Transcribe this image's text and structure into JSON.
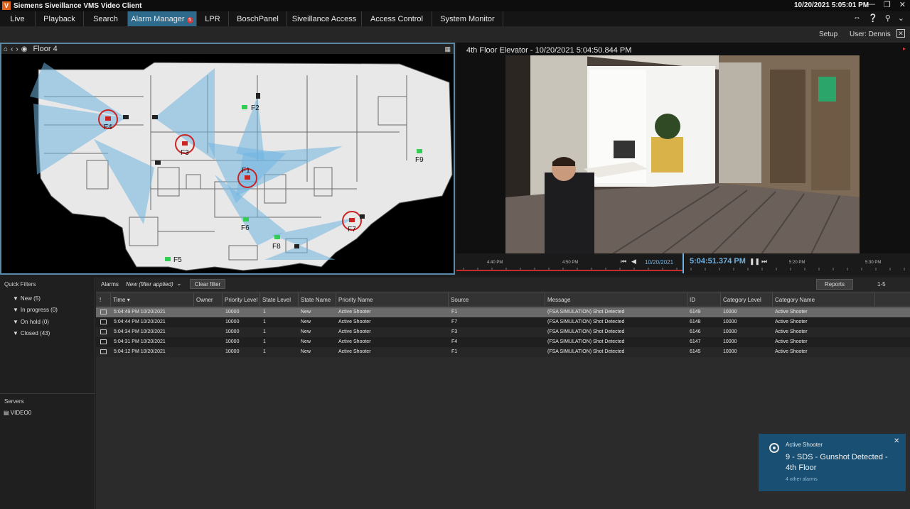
{
  "app": {
    "title": "Siemens Siveillance VMS Video Client",
    "logo_letter": "V",
    "clock": "10/20/2021 5:05:01 PM"
  },
  "tabs": [
    {
      "label": "Live"
    },
    {
      "label": "Playback"
    },
    {
      "label": "Search"
    },
    {
      "label": "Alarm Manager",
      "badge": "5"
    },
    {
      "label": "LPR"
    },
    {
      "label": "BoschPanel"
    },
    {
      "label": "Siveillance Access"
    },
    {
      "label": "Access Control"
    },
    {
      "label": "System Monitor"
    }
  ],
  "subbar": {
    "setup": "Setup",
    "user": "User: Dennis"
  },
  "map": {
    "title": "Floor 4",
    "markers": [
      "F1",
      "F2",
      "F3",
      "F4",
      "F5",
      "F6",
      "F7",
      "F8",
      "F9"
    ]
  },
  "video": {
    "title": "4th Floor Elevator - 10/20/2021 5:04:50.844 PM",
    "timeline": {
      "labels": [
        "4:40 PM",
        "4:50 PM",
        "5:20 PM",
        "5:30 PM"
      ],
      "date": "10/20/2021",
      "time": "5:04:51.374 PM"
    }
  },
  "quick_filters": {
    "title": "Quick Filters",
    "items": [
      {
        "label": "New (5)"
      },
      {
        "label": "In progress (0)"
      },
      {
        "label": "On hold (0)"
      },
      {
        "label": "Closed (43)"
      }
    ]
  },
  "servers": {
    "title": "Servers",
    "items": [
      "VIDEO0"
    ]
  },
  "alarms": {
    "label": "Alarms",
    "filter": "New (filter applied)",
    "clear_filter": "Clear filter",
    "reports": "Reports",
    "page": "1-5",
    "columns": [
      "!",
      "Time",
      "Owner",
      "Priority Level",
      "State Level",
      "State Name",
      "Priority Name",
      "Source",
      "Message",
      "ID",
      "Category Level",
      "Category Name"
    ],
    "rows": [
      {
        "time": "5:04:49 PM 10/20/2021",
        "owner": "",
        "priority_level": "10000",
        "state_level": "1",
        "state_name": "New",
        "priority_name": "Active Shooter",
        "source": "F1",
        "message": "(FSA SIMULATION) Shot Detected",
        "id": "6149",
        "category_level": "10000",
        "category_name": "Active Shooter"
      },
      {
        "time": "5:04:44 PM 10/20/2021",
        "owner": "",
        "priority_level": "10000",
        "state_level": "1",
        "state_name": "New",
        "priority_name": "Active Shooter",
        "source": "F7",
        "message": "(FSA SIMULATION) Shot Detected",
        "id": "6148",
        "category_level": "10000",
        "category_name": "Active Shooter"
      },
      {
        "time": "5:04:34 PM 10/20/2021",
        "owner": "",
        "priority_level": "10000",
        "state_level": "1",
        "state_name": "New",
        "priority_name": "Active Shooter",
        "source": "F3",
        "message": "(FSA SIMULATION) Shot Detected",
        "id": "6146",
        "category_level": "10000",
        "category_name": "Active Shooter"
      },
      {
        "time": "5:04:31 PM 10/20/2021",
        "owner": "",
        "priority_level": "10000",
        "state_level": "1",
        "state_name": "New",
        "priority_name": "Active Shooter",
        "source": "F4",
        "message": "(FSA SIMULATION) Shot Detected",
        "id": "6147",
        "category_level": "10000",
        "category_name": "Active Shooter"
      },
      {
        "time": "5:04:12 PM 10/20/2021",
        "owner": "",
        "priority_level": "10000",
        "state_level": "1",
        "state_name": "New",
        "priority_name": "Active Shooter",
        "source": "F1",
        "message": "(FSA SIMULATION) Shot Detected",
        "id": "6145",
        "category_level": "10000",
        "category_name": "Active Shooter"
      }
    ]
  },
  "toast": {
    "title": "Active Shooter",
    "message": "9 - SDS - Gunshot Detected - 4th Floor",
    "more": "4 other alarms"
  },
  "colors": {
    "accent": "#2e6a8c",
    "alarm_red": "#d23a3a",
    "toast_bg": "#184f72",
    "time_blue": "#6fb0e0"
  }
}
